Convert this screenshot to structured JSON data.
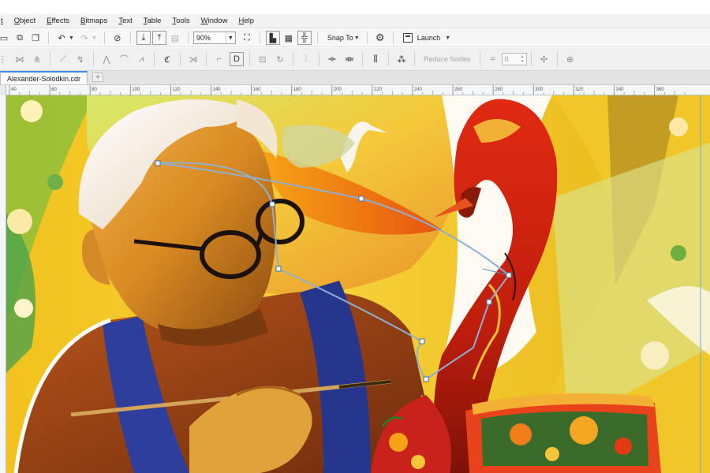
{
  "menu": {
    "items": [
      "t",
      "Object",
      "Effects",
      "Bitmaps",
      "Text",
      "Table",
      "Tools",
      "Window",
      "Help"
    ]
  },
  "toolbar": {
    "zoom_value": "90%",
    "snap_label": "Snap To",
    "launch_label": "Launch"
  },
  "propbar": {
    "reduce_nodes_label": "Reduce Nodes",
    "smoothness_value": "0"
  },
  "document": {
    "tab_title": "Alexander-Solodkin.cdr"
  },
  "ruler": {
    "ticks": [
      "40",
      "60",
      "80",
      "100",
      "120",
      "140",
      "160",
      "180",
      "200",
      "220",
      "240",
      "260",
      "280",
      "300",
      "320",
      "340",
      "360"
    ]
  },
  "colors": {
    "accent": "#3a8ee6",
    "selection_path": "#8fb0d2"
  },
  "icons": {
    "toolbar": [
      "new-document-icon",
      "copy-icon",
      "paste-icon",
      "undo-icon",
      "redo-icon",
      "search-icon",
      "import-icon",
      "export-icon",
      "publish-pdf-icon",
      "full-screen-icon",
      "show-rulers-icon",
      "show-grid-icon",
      "show-guidelines-icon",
      "options-gear-icon",
      "launch-icon"
    ],
    "propbar": [
      "add-node-icon",
      "delete-node-icon",
      "join-nodes-icon",
      "break-curve-icon",
      "to-line-icon",
      "to-curve-icon",
      "cusp-node-icon",
      "smooth-node-icon",
      "symmetrical-node-icon",
      "reverse-direction-icon",
      "extend-curve-icon",
      "extract-subpath-icon",
      "close-curve-icon",
      "stretch-nodes-icon",
      "rotate-nodes-icon",
      "align-nodes-icon",
      "mirror-horizontal-icon",
      "mirror-vertical-icon",
      "elastic-mode-icon",
      "select-all-nodes-icon",
      "curve-smoothness-icon",
      "node-tracking-icon",
      "auto-close-icon"
    ]
  }
}
